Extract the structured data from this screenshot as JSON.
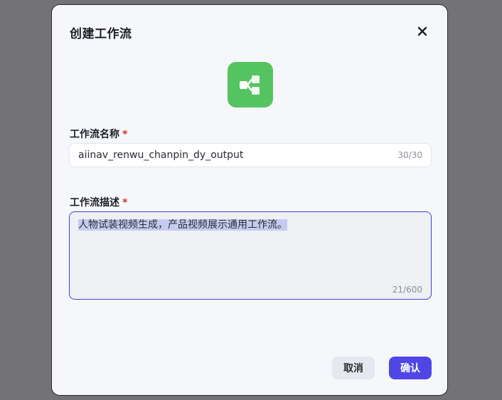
{
  "dialog": {
    "title": "创建工作流",
    "close_icon": "close-icon",
    "app_icon": "workflow-icon",
    "app_icon_color": "#54c460"
  },
  "form": {
    "name": {
      "label": "工作流名称",
      "required_mark": "*",
      "value": "aiinav_renwu_chanpin_dy_output",
      "counter": "30/30"
    },
    "description": {
      "label": "工作流描述",
      "required_mark": "*",
      "value": "人物试装视频生成，产品视频展示通用工作流。",
      "counter": "21/600"
    }
  },
  "actions": {
    "cancel_label": "取消",
    "confirm_label": "确认",
    "confirm_color": "#4f46e5"
  }
}
